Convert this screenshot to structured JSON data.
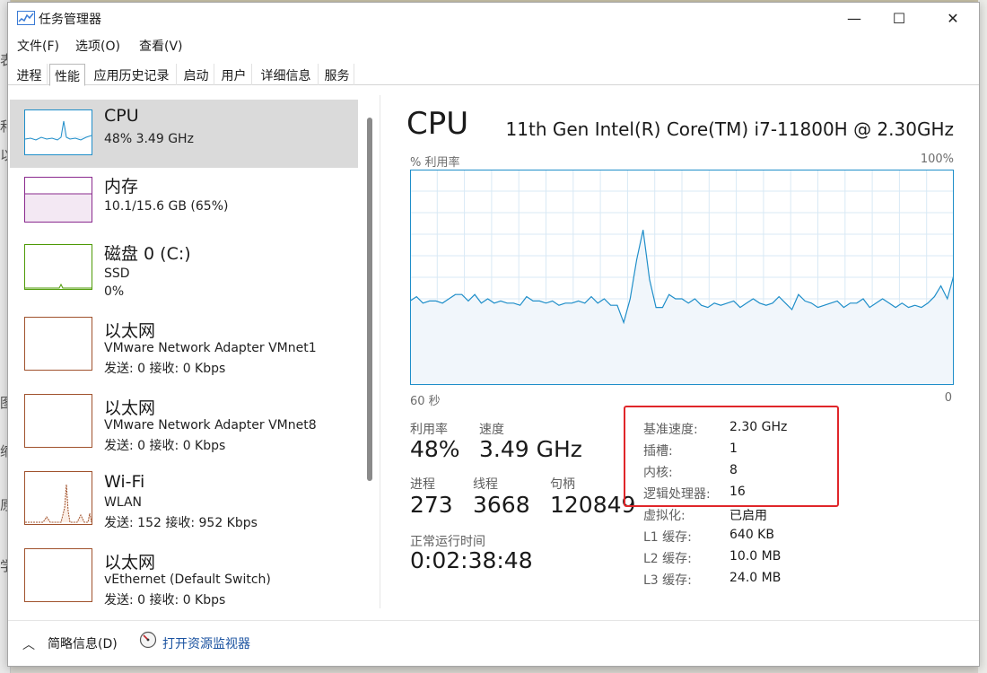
{
  "window": {
    "title": "任务管理器",
    "minimize_glyph": "—",
    "maximize_glyph": "☐",
    "close_glyph": "✕"
  },
  "menu": [
    "文件(F)",
    "选项(O)",
    "查看(V)"
  ],
  "tabs": [
    {
      "label": "进程",
      "active": false
    },
    {
      "label": "性能",
      "active": true
    },
    {
      "label": "应用历史记录",
      "active": false
    },
    {
      "label": "启动",
      "active": false
    },
    {
      "label": "用户",
      "active": false
    },
    {
      "label": "详细信息",
      "active": false
    },
    {
      "label": "服务",
      "active": false
    }
  ],
  "sidebar": {
    "items": [
      {
        "name": "CPU",
        "line1": "48% 3.49 GHz",
        "line2": "",
        "color": "#1f8ec9"
      },
      {
        "name": "内存",
        "line1": "10.1/15.6 GB (65%)",
        "line2": "",
        "color": "#8a2a8e"
      },
      {
        "name": "磁盘 0 (C:)",
        "line1": "SSD",
        "line2": "0%",
        "color": "#4e9a06"
      },
      {
        "name": "以太网",
        "line1": "VMware Network Adapter VMnet1",
        "line2": "发送: 0 接收: 0 Kbps",
        "color": "#a0522d"
      },
      {
        "name": "以太网",
        "line1": "VMware Network Adapter VMnet8",
        "line2": "发送: 0 接收: 0 Kbps",
        "color": "#a0522d"
      },
      {
        "name": "Wi-Fi",
        "line1": "WLAN",
        "line2": "发送: 152 接收: 952 Kbps",
        "color": "#a0522d"
      },
      {
        "name": "以太网",
        "line1": "vEthernet (Default Switch)",
        "line2": "发送: 0 接收: 0 Kbps",
        "color": "#a0522d"
      }
    ]
  },
  "main": {
    "title": "CPU",
    "model": "11th Gen Intel(R) Core(TM) i7-11800H @ 2.30GHz",
    "graph": {
      "y_label": "% 利用率",
      "y_max_label": "100%",
      "x_left_label": "60 秒",
      "x_right_label": "0",
      "line_color": "#1f8ec9",
      "fill_color": "#f1f6fb",
      "grid_color": "#d9e9f5",
      "values": [
        39,
        41,
        38,
        39,
        39,
        38,
        40,
        42,
        42,
        39,
        42,
        38,
        40,
        38,
        39,
        38,
        38,
        37,
        41,
        39,
        39,
        38,
        39,
        37,
        38,
        38,
        39,
        38,
        41,
        38,
        40,
        37,
        37,
        29,
        40,
        58,
        72,
        49,
        36,
        36,
        42,
        40,
        40,
        38,
        40,
        37,
        36,
        38,
        37,
        38,
        39,
        36,
        38,
        40,
        38,
        37,
        38,
        41,
        38,
        35,
        42,
        39,
        38,
        36,
        37,
        38,
        39,
        36,
        38,
        38,
        40,
        36,
        38,
        40,
        38,
        36,
        38,
        36,
        37,
        36,
        38,
        41,
        46,
        40,
        51
      ]
    },
    "stats": {
      "utilization_label": "利用率",
      "utilization_value": "48%",
      "speed_label": "速度",
      "speed_value": "3.49 GHz",
      "processes_label": "进程",
      "processes_value": "273",
      "threads_label": "线程",
      "threads_value": "3668",
      "handles_label": "句柄",
      "handles_value": "120849",
      "uptime_label": "正常运行时间",
      "uptime_value": "0:02:38:48"
    },
    "details": [
      {
        "label": "基准速度:",
        "value": "2.30 GHz"
      },
      {
        "label": "插槽:",
        "value": "1"
      },
      {
        "label": "内核:",
        "value": "8"
      },
      {
        "label": "逻辑处理器:",
        "value": "16"
      },
      {
        "label": "虚拟化:",
        "value": "已启用"
      },
      {
        "label": "L1 缓存:",
        "value": "640 KB"
      },
      {
        "label": "L2 缓存:",
        "value": "10.0 MB"
      },
      {
        "label": "L3 缓存:",
        "value": "24.0 MB"
      }
    ],
    "highlight_color": "#e0262a"
  },
  "footer": {
    "summary_label": "简略信息(D)",
    "monitor_link": "打开资源监视器"
  },
  "background_fragments": [
    "表",
    "和",
    "以",
    "图",
    "缩",
    "原",
    "学"
  ]
}
